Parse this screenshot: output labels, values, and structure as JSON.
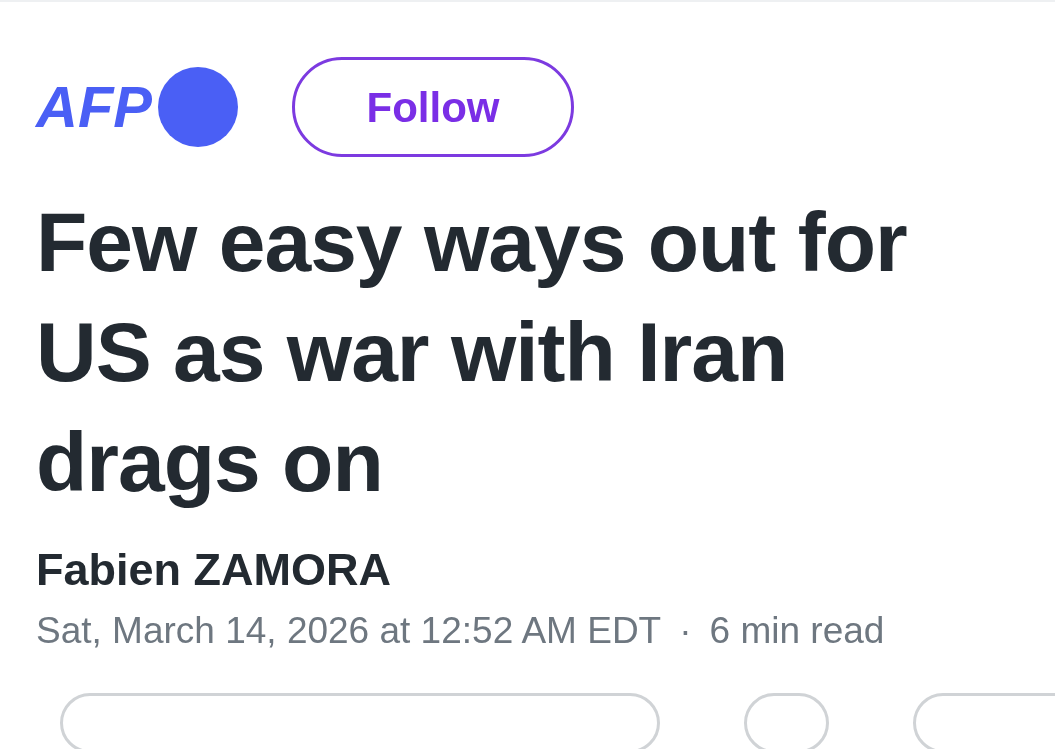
{
  "source": {
    "logo": "AFP",
    "follow_button": "Follow"
  },
  "headline": "Few easy ways out for US as war with Iran drags on",
  "author": "Fabien ZAMORA",
  "meta": {
    "date": "Sat, March 14, 2026 at 12:52 AM EDT",
    "separator": "·",
    "read_time": "6 min read"
  }
}
